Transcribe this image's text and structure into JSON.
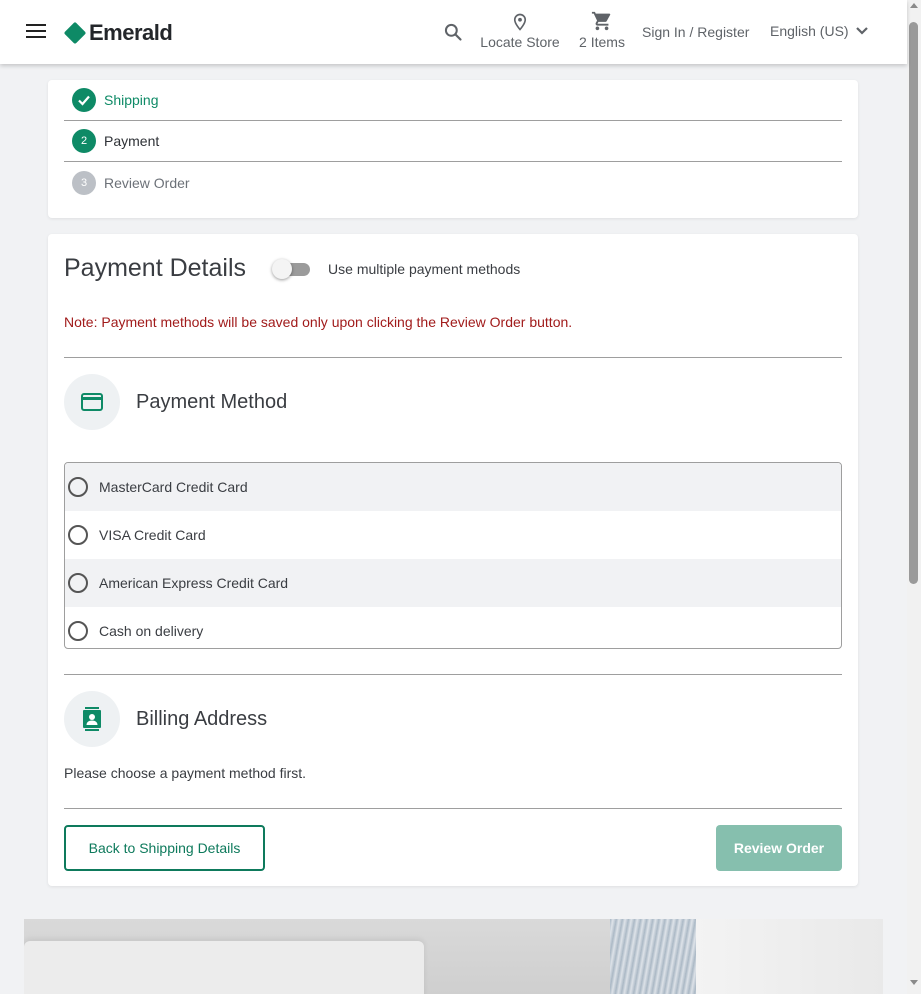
{
  "header": {
    "brand": "Emerald",
    "locate_label": "Locate Store",
    "cart_label": "2 Items",
    "signin_label": "Sign In / Register",
    "language_label": "English (US)"
  },
  "steps": [
    {
      "label": "Shipping",
      "number": "",
      "state": "done"
    },
    {
      "label": "Payment",
      "number": "2",
      "state": "active"
    },
    {
      "label": "Review Order",
      "number": "3",
      "state": "todo"
    }
  ],
  "payment": {
    "title": "Payment Details",
    "multiple_label": "Use multiple payment methods",
    "multiple_enabled": false,
    "note": "Note: Payment methods will be saved only upon clicking the Review Order button.",
    "method_title": "Payment Method",
    "options": [
      {
        "label": "MasterCard Credit Card",
        "selected": false
      },
      {
        "label": "VISA Credit Card",
        "selected": false
      },
      {
        "label": "American Express Credit Card",
        "selected": false
      },
      {
        "label": "Cash on delivery",
        "selected": false
      }
    ],
    "billing_title": "Billing Address",
    "billing_note": "Please choose a payment method first.",
    "back_label": "Back to Shipping Details",
    "review_label": "Review Order"
  },
  "colors": {
    "brand": "#0e8a66",
    "note": "#a11b1b",
    "review_disabled": "#86bfae"
  }
}
